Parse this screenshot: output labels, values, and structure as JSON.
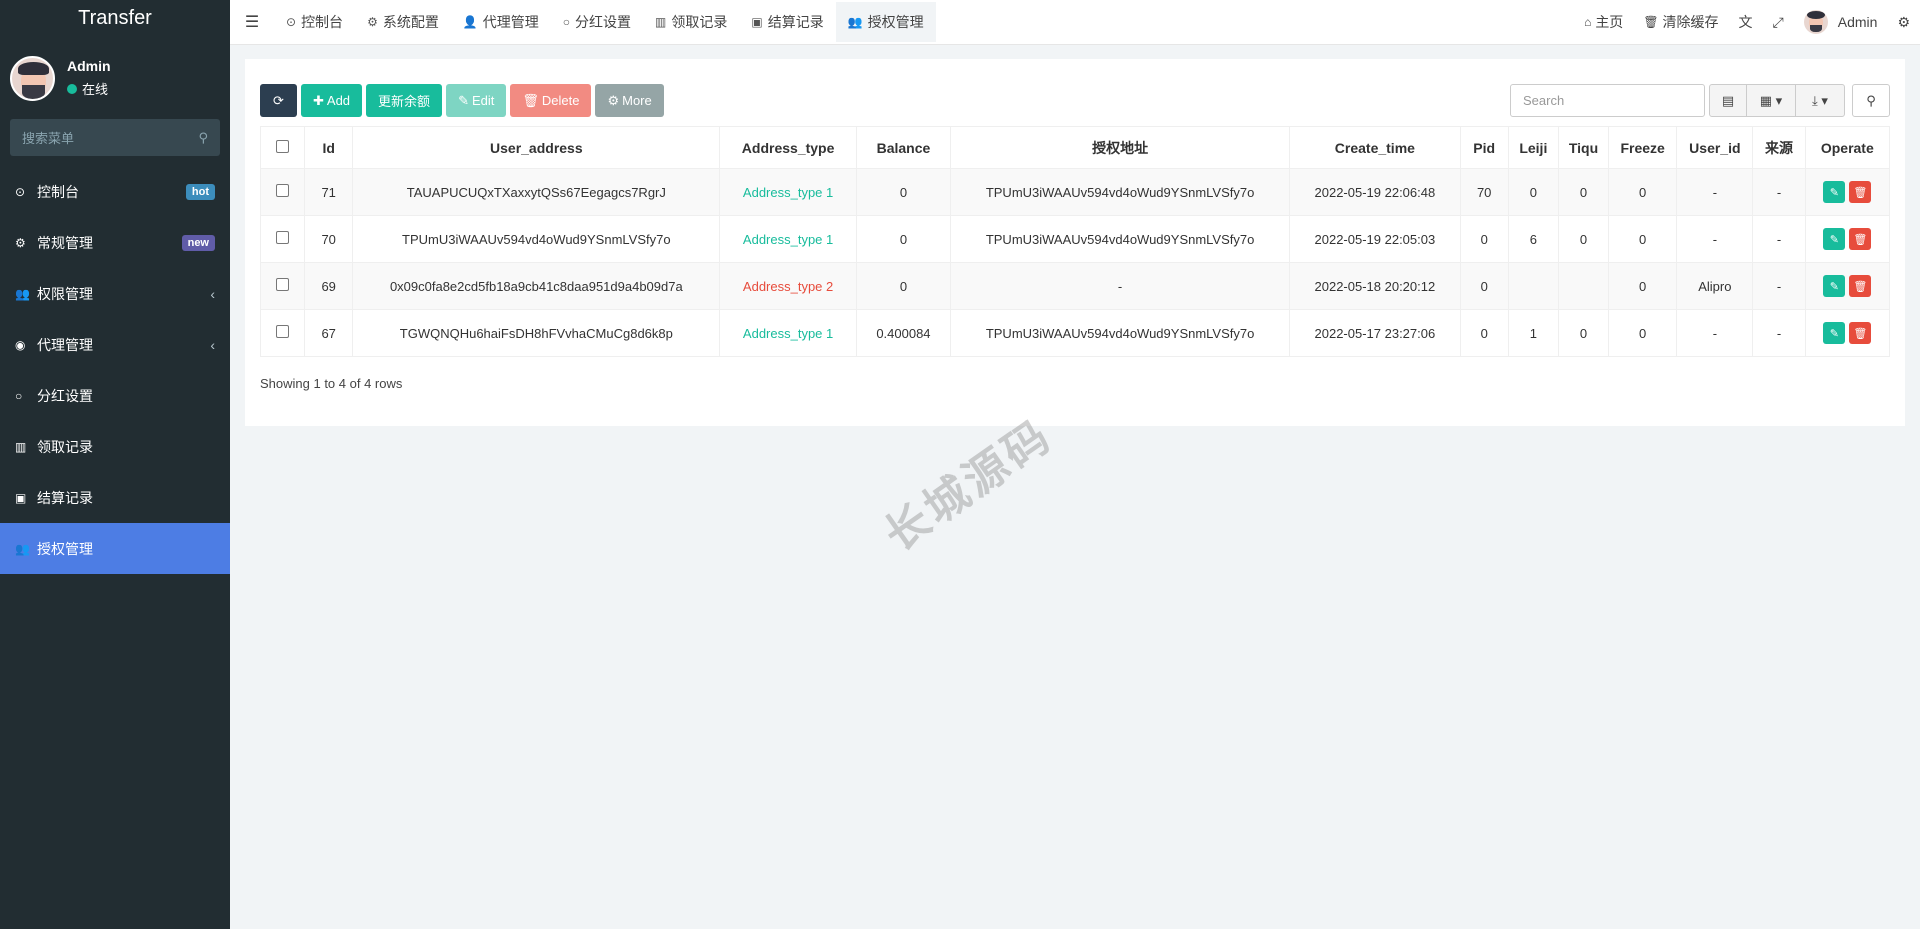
{
  "brand": "Transfer",
  "user": {
    "name": "Admin",
    "status": "在线"
  },
  "sidebar": {
    "search_placeholder": "搜索菜单",
    "items": [
      {
        "icon": "dashboard-icon",
        "glyph": "⊙",
        "label": "控制台",
        "badge": "hot"
      },
      {
        "icon": "cogs-icon",
        "glyph": "⚙",
        "label": "常规管理",
        "badge": "new"
      },
      {
        "icon": "group-icon",
        "glyph": "👥",
        "label": "权限管理",
        "chevron": "‹"
      },
      {
        "icon": "user-circle-icon",
        "glyph": "◉",
        "label": "代理管理",
        "chevron": "‹"
      },
      {
        "icon": "circle-icon",
        "glyph": "○",
        "label": "分红设置"
      },
      {
        "icon": "chart-icon",
        "glyph": "▥",
        "label": "领取记录"
      },
      {
        "icon": "calc-icon",
        "glyph": "▣",
        "label": "结算记录"
      },
      {
        "icon": "group-icon",
        "glyph": "👥",
        "label": "授权管理",
        "active": true
      }
    ]
  },
  "topnav": {
    "tabs": [
      {
        "icon": "dashboard-icon",
        "glyph": "⊙",
        "label": "控制台"
      },
      {
        "icon": "gear-icon",
        "glyph": "⚙",
        "label": "系统配置"
      },
      {
        "icon": "user-icon",
        "glyph": "👤",
        "label": "代理管理"
      },
      {
        "icon": "circle-icon",
        "glyph": "○",
        "label": "分红设置"
      },
      {
        "icon": "chart-icon",
        "glyph": "▥",
        "label": "领取记录"
      },
      {
        "icon": "calc-icon",
        "glyph": "▣",
        "label": "结算记录"
      },
      {
        "icon": "group-icon",
        "glyph": "👥",
        "label": "授权管理",
        "active": true
      }
    ],
    "home": "主页",
    "clear_cache": "清除缓存",
    "admin": "Admin"
  },
  "toolbar": {
    "add": "Add",
    "update_balance": "更新余额",
    "edit": "Edit",
    "delete": "Delete",
    "more": "More",
    "search_placeholder": "Search"
  },
  "table": {
    "headers": [
      "Id",
      "User_address",
      "Address_type",
      "Balance",
      "授权地址",
      "Create_time",
      "Pid",
      "Leiji",
      "Tiqu",
      "Freeze",
      "User_id",
      "来源",
      "Operate"
    ],
    "rows": [
      {
        "id": "71",
        "user_address": "TAUAPUCUQxTXaxxytQSs67Eegagcs7RgrJ",
        "address_type": "Address_type 1",
        "type_color": "green",
        "balance": "0",
        "auth_address": "TPUmU3iWAAUv594vd4oWud9YSnmLVSfy7o",
        "create_time": "2022-05-19 22:06:48",
        "pid": "70",
        "leiji": "0",
        "tiqu": "0",
        "freeze": "0",
        "user_id": "-",
        "source": "-"
      },
      {
        "id": "70",
        "user_address": "TPUmU3iWAAUv594vd4oWud9YSnmLVSfy7o",
        "address_type": "Address_type 1",
        "type_color": "green",
        "balance": "0",
        "auth_address": "TPUmU3iWAAUv594vd4oWud9YSnmLVSfy7o",
        "create_time": "2022-05-19 22:05:03",
        "pid": "0",
        "leiji": "6",
        "tiqu": "0",
        "freeze": "0",
        "user_id": "-",
        "source": "-"
      },
      {
        "id": "69",
        "user_address": "0x09c0fa8e2cd5fb18a9cb41c8daa951d9a4b09d7a",
        "address_type": "Address_type 2",
        "type_color": "red",
        "balance": "0",
        "auth_address": "-",
        "create_time": "2022-05-18 20:20:12",
        "pid": "0",
        "leiji": "",
        "tiqu": "",
        "freeze": "0",
        "user_id": "Alipro",
        "source": "-"
      },
      {
        "id": "67",
        "user_address": "TGWQNQHu6haiFsDH8hFVvhaCMuCg8d6k8p",
        "address_type": "Address_type 1",
        "type_color": "green",
        "balance": "0.400084",
        "auth_address": "TPUmU3iWAAUv594vd4oWud9YSnmLVSfy7o",
        "create_time": "2022-05-17 23:27:06",
        "pid": "0",
        "leiji": "1",
        "tiqu": "0",
        "freeze": "0",
        "user_id": "-",
        "source": "-"
      }
    ],
    "footer": "Showing 1 to 4 of 4 rows"
  },
  "watermark": "长城源码",
  "colors": {
    "sidebar_bg": "#222d32",
    "active_menu": "#4d7de4",
    "success": "#18bc9c",
    "danger": "#e74c3c"
  }
}
